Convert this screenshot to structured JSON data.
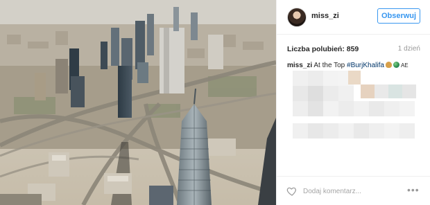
{
  "post": {
    "username": "miss_zi",
    "follow_label": "Obserwuj",
    "likes_label": "Liczba polubień: 859",
    "time_label": "1 dzień",
    "caption": {
      "username": "miss_zi",
      "text": "At the Top",
      "hashtag": "#BurjKhalifa",
      "emoji_icons": [
        "praying-hands-icon",
        "globe-icon"
      ],
      "flag_code": "AE"
    },
    "comment_placeholder": "Dodaj komentarz...",
    "more_label": "•••"
  },
  "photo": {
    "description_icon": "dubai-skyline-photo"
  },
  "colors": {
    "accent": "#3897f0",
    "hashtag": "#003569",
    "muted": "#999999",
    "border": "#efefef"
  }
}
